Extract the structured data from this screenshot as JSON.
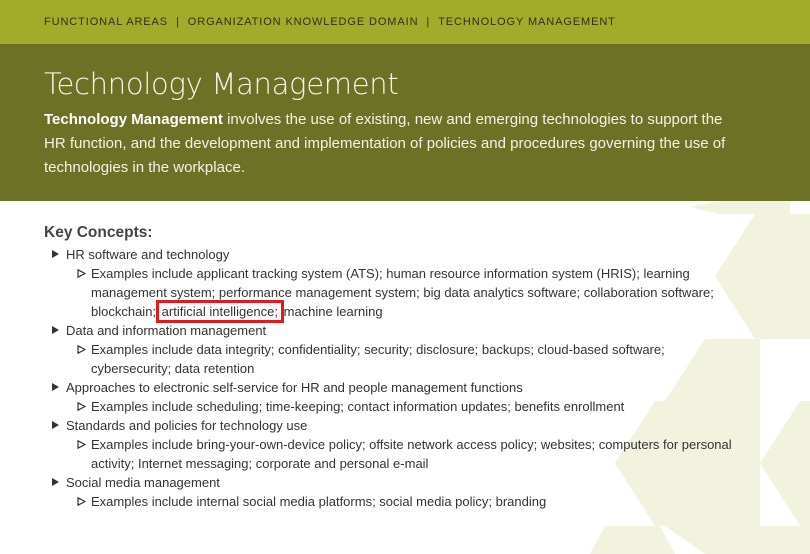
{
  "breadcrumb": {
    "items": [
      "FUNCTIONAL AREAS",
      "ORGANIZATION KNOWLEDGE DOMAIN",
      "TECHNOLOGY MANAGEMENT"
    ],
    "separator": "|"
  },
  "hero": {
    "title": "Technology Management",
    "desc_bold": "Technology Management",
    "desc_rest": " involves the use of existing, new and emerging technologies to support the HR function, and the development and implementation of policies and procedures governing the use of technologies in the workplace."
  },
  "concepts": {
    "title": "Key Concepts:",
    "items": [
      {
        "label": "HR software and technology",
        "sub_before": "Examples include applicant tracking system (ATS); human resource information system (HRIS); learning management system; performance management system; big data analytics software; collaboration software; blockchain; ",
        "sub_highlight": "artificial intelligence;",
        "sub_after": " machine learning"
      },
      {
        "label": "Data and information management",
        "sub": "Examples include data integrity; confidentiality; security; disclosure; backups; cloud-based software; cybersecurity; data retention"
      },
      {
        "label": "Approaches to electronic self-service for HR and people management functions",
        "sub": "Examples include scheduling; time-keeping; contact information updates; benefits enrollment"
      },
      {
        "label": "Standards and policies for technology use",
        "sub": "Examples include bring-your-own-device policy; offsite network access policy; websites; computers for personal activity; Internet messaging; corporate and personal e-mail"
      },
      {
        "label": "Social media management",
        "sub": "Examples include internal social media platforms; social media policy; branding"
      }
    ]
  },
  "colors": {
    "top_bar": "#a3ab2b",
    "hero": "#6d7125",
    "highlight_box": "#e01b1b",
    "hex_pattern": "#f1f3de"
  }
}
